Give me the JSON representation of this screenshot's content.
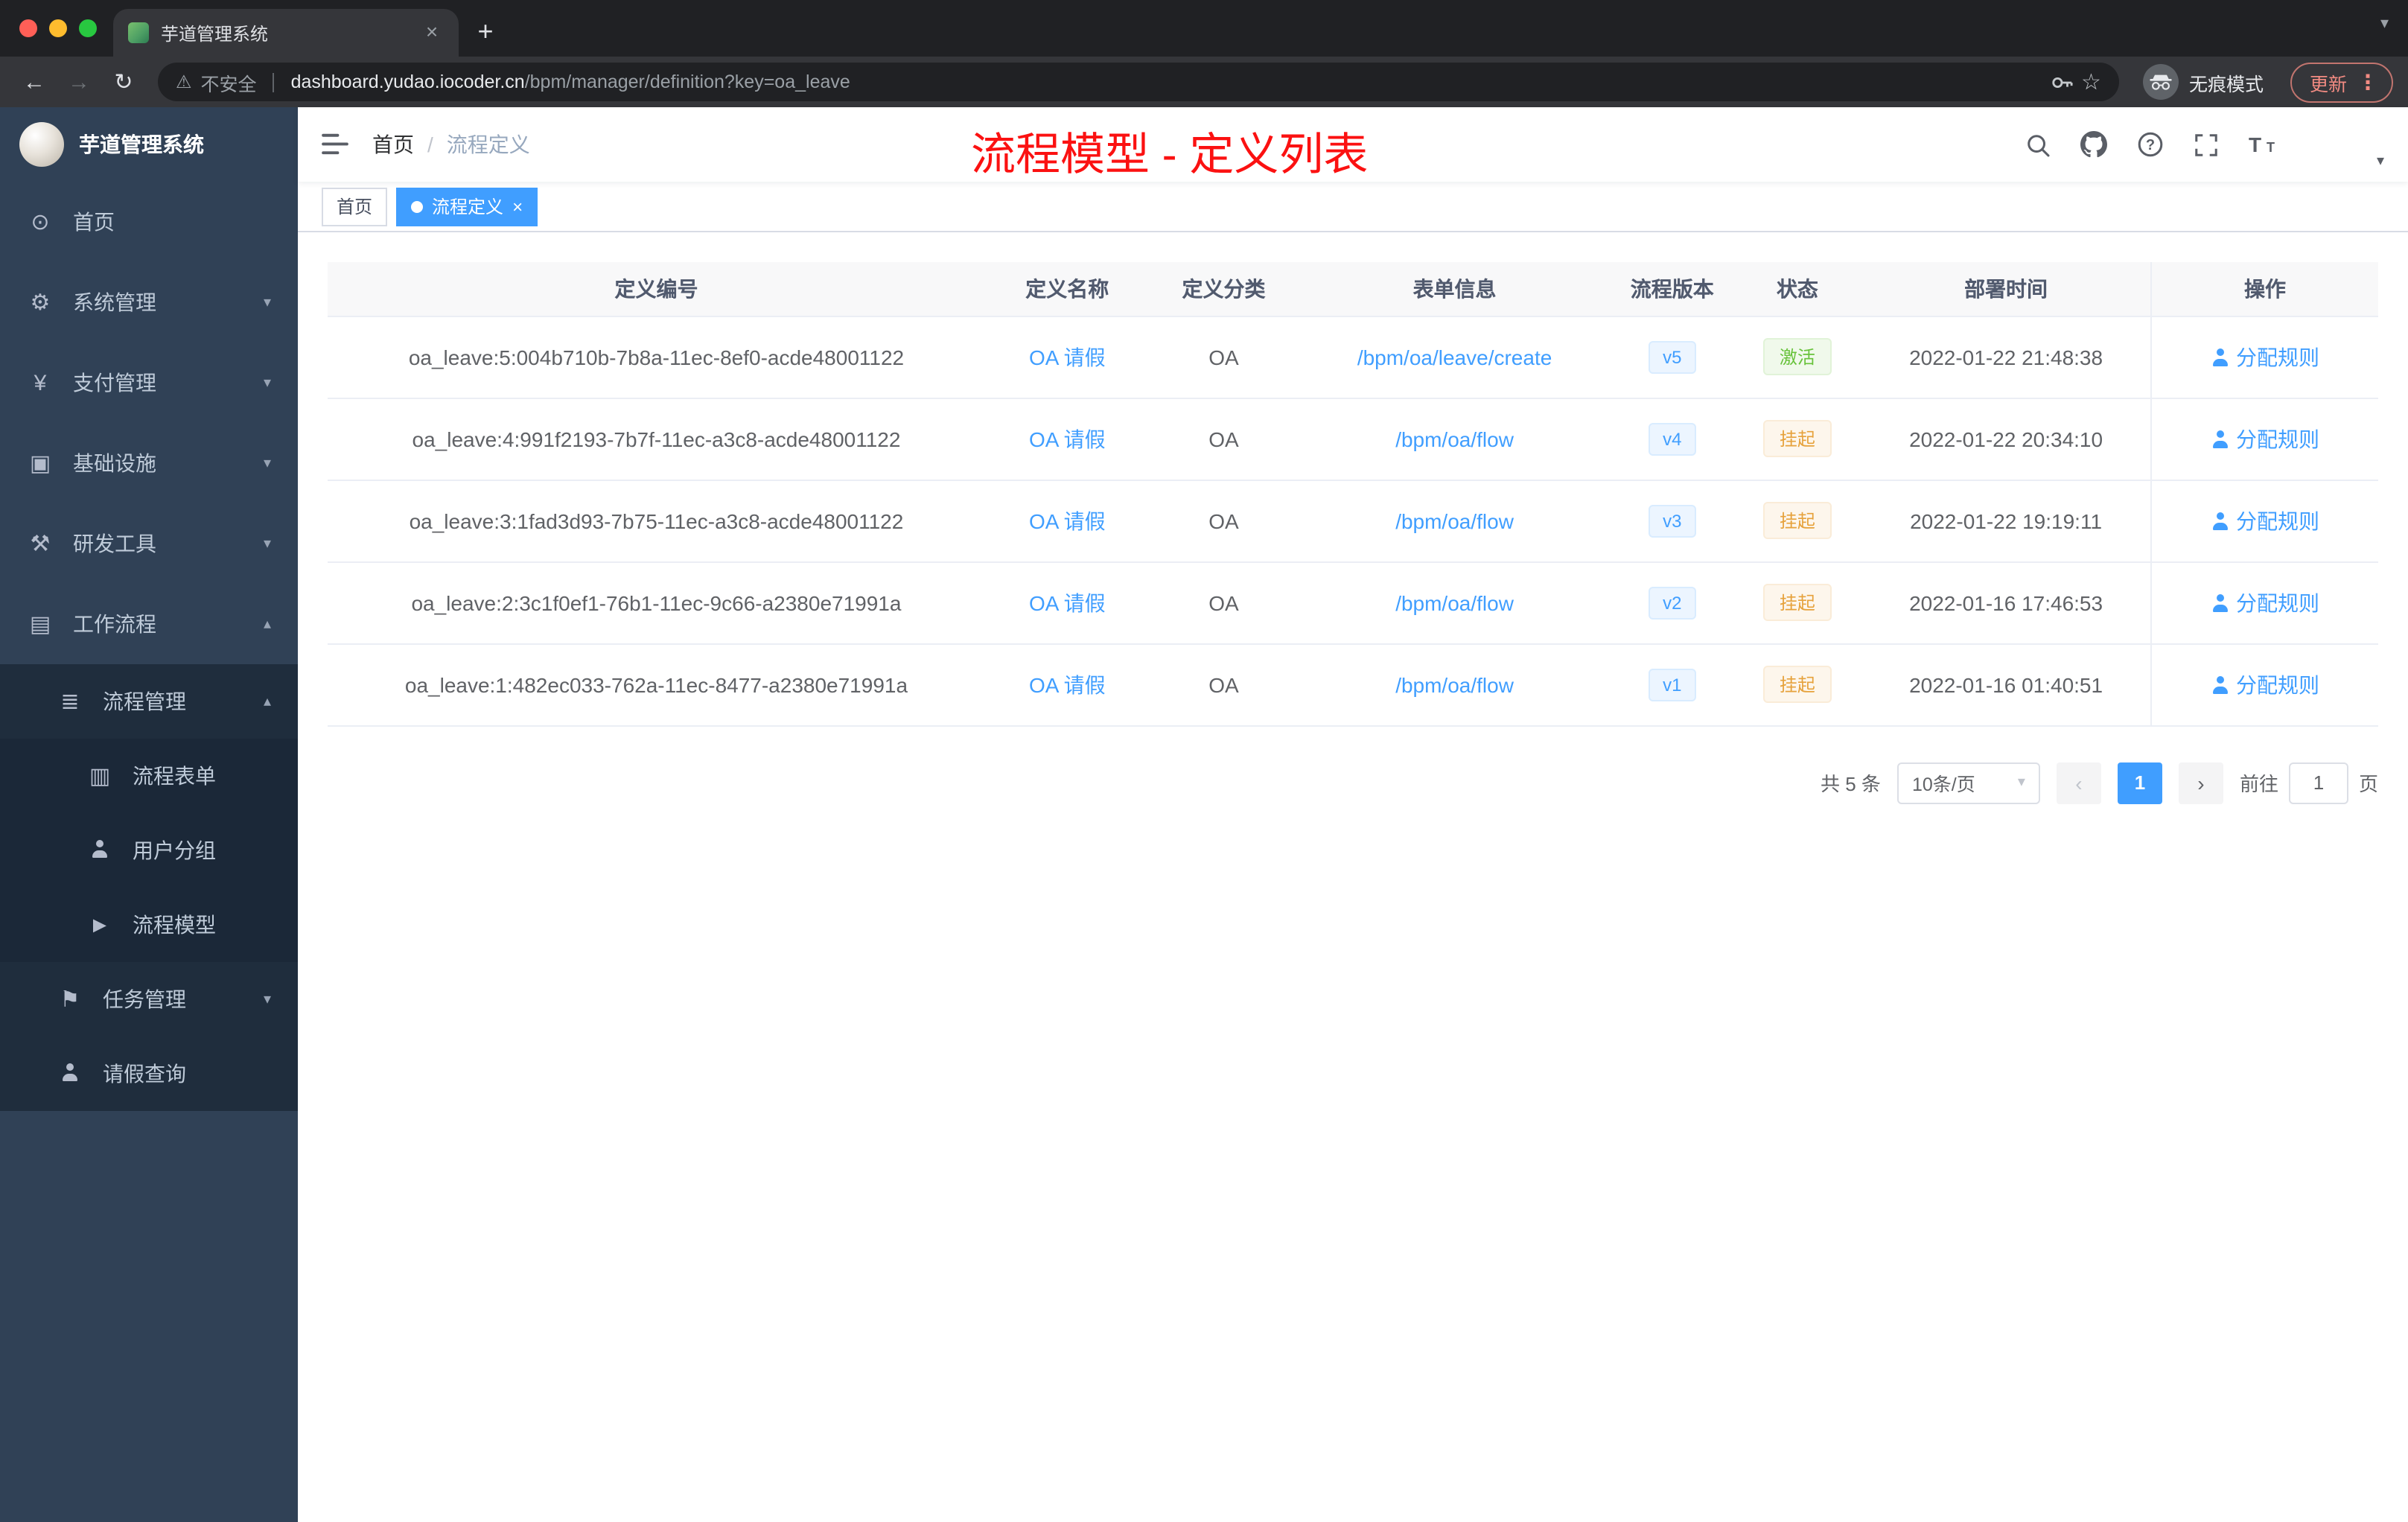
{
  "colors": {
    "accent": "#409eff",
    "success": "#67c23a",
    "warning": "#e6a23c",
    "annotation_red": "#fb1111",
    "sidebar_bg": "#304156"
  },
  "icons": {
    "back": "←",
    "forward": "→",
    "reload": "↻",
    "warning": "⚠",
    "star": "☆",
    "more_vertical": "⋮",
    "new_tab": "+",
    "tab_close": "×",
    "tab_chevron": "▾",
    "tag_close": "×",
    "chevron_down": "▾",
    "chevron_up": "▴",
    "page_prev": "‹",
    "page_next": "›"
  },
  "browser": {
    "tab": {
      "title": "芋道管理系统"
    },
    "address": {
      "security_label": "不安全",
      "url_host": "dashboard.yudao.iocoder.cn",
      "url_path": "/bpm/manager/definition?key=oa_leave",
      "incognito_label": "无痕模式",
      "update_label": "更新"
    }
  },
  "sidebar": {
    "logo_title": "芋道管理系统",
    "items": [
      {
        "label": "首页",
        "glyph": "⊙"
      },
      {
        "label": "系统管理",
        "glyph": "⚙"
      },
      {
        "label": "支付管理",
        "glyph": "¥"
      },
      {
        "label": "基础设施",
        "glyph": "▣"
      },
      {
        "label": "研发工具",
        "glyph": "⚒"
      },
      {
        "label": "工作流程",
        "glyph": "▤"
      }
    ],
    "process_group": {
      "label": "流程管理",
      "glyph": "≣",
      "children": [
        {
          "label": "流程表单",
          "glyph": "▥"
        },
        {
          "label": "用户分组"
        },
        {
          "label": "流程模型",
          "glyph": "►"
        }
      ]
    },
    "task_group": {
      "label": "任务管理",
      "glyph": "⚑"
    },
    "leave_item": {
      "label": "请假查询"
    }
  },
  "navbar": {
    "breadcrumb": {
      "home": "首页",
      "sep": "/",
      "current": "流程定义"
    },
    "annotation": "流程模型 - 定义列表"
  },
  "tags": [
    {
      "label": "首页"
    },
    {
      "label": "流程定义"
    }
  ],
  "table": {
    "columns": [
      "定义编号",
      "定义名称",
      "定义分类",
      "表单信息",
      "流程版本",
      "状态",
      "部署时间",
      "操作"
    ],
    "rows": [
      {
        "id": "oa_leave:5:004b710b-7b8a-11ec-8ef0-acde48001122",
        "name": "OA 请假",
        "category": "OA",
        "form": "/bpm/oa/leave/create",
        "version": "v5",
        "status": "激活",
        "deployed": "2022-01-22 21:48:38",
        "action": "分配规则"
      },
      {
        "id": "oa_leave:4:991f2193-7b7f-11ec-a3c8-acde48001122",
        "name": "OA 请假",
        "category": "OA",
        "form": "/bpm/oa/flow",
        "version": "v4",
        "status": "挂起",
        "deployed": "2022-01-22 20:34:10",
        "action": "分配规则"
      },
      {
        "id": "oa_leave:3:1fad3d93-7b75-11ec-a3c8-acde48001122",
        "name": "OA 请假",
        "category": "OA",
        "form": "/bpm/oa/flow",
        "version": "v3",
        "status": "挂起",
        "deployed": "2022-01-22 19:19:11",
        "action": "分配规则"
      },
      {
        "id": "oa_leave:2:3c1f0ef1-76b1-11ec-9c66-a2380e71991a",
        "name": "OA 请假",
        "category": "OA",
        "form": "/bpm/oa/flow",
        "version": "v2",
        "status": "挂起",
        "deployed": "2022-01-16 17:46:53",
        "action": "分配规则"
      },
      {
        "id": "oa_leave:1:482ec033-762a-11ec-8477-a2380e71991a",
        "name": "OA 请假",
        "category": "OA",
        "form": "/bpm/oa/flow",
        "version": "v1",
        "status": "挂起",
        "deployed": "2022-01-16 01:40:51",
        "action": "分配规则"
      }
    ]
  },
  "pagination": {
    "total": "共 5 条",
    "page_size": "10条/页",
    "current_page": "1",
    "goto_label": "前往",
    "goto_value": "1",
    "goto_unit": "页"
  }
}
